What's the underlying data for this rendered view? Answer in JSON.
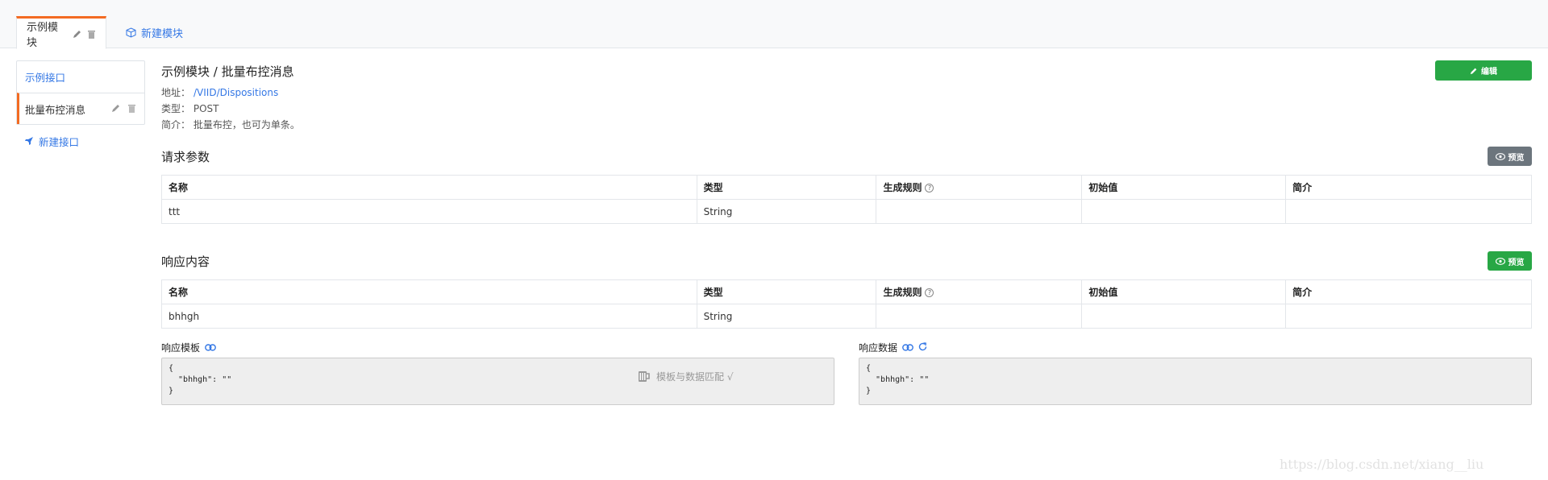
{
  "tabs": {
    "active_label": "示例模块",
    "new_label": "新建模块"
  },
  "sidebar": {
    "items": [
      {
        "label": "示例接口"
      },
      {
        "label": "批量布控消息"
      }
    ],
    "new_label": "新建接口"
  },
  "page": {
    "title": "示例模块 / 批量布控消息",
    "edit_label": "编辑",
    "address_label": "地址：",
    "address_value": "/VIID/Dispositions",
    "type_label": "类型：",
    "type_value": "POST",
    "desc_label": "简介：",
    "desc_value": "批量布控，也可为单条。"
  },
  "request": {
    "title": "请求参数",
    "preview_label": "预览",
    "columns": [
      "名称",
      "类型",
      "生成规则",
      "初始值",
      "简介"
    ],
    "rows": [
      {
        "name": "ttt",
        "type": "String",
        "rule": "",
        "init": "",
        "desc": ""
      }
    ]
  },
  "response": {
    "title": "响应内容",
    "preview_label": "预览",
    "columns": [
      "名称",
      "类型",
      "生成规则",
      "初始值",
      "简介"
    ],
    "rows": [
      {
        "name": "bhhgh",
        "type": "String",
        "rule": "",
        "init": "",
        "desc": ""
      }
    ],
    "template_label": "响应模板",
    "template_code": "{\n  \"bhhgh\": \"\"\n}",
    "data_label": "响应数据",
    "data_code": "{\n  \"bhhgh\": \"\"\n}"
  },
  "match_text": "模板与数据匹配 √",
  "watermark": "https://blog.csdn.net/xiang__liu",
  "colors": {
    "accent_orange": "#f36b22",
    "link_blue": "#3578e5",
    "button_green": "#28a745",
    "button_gray": "#6c757d"
  }
}
